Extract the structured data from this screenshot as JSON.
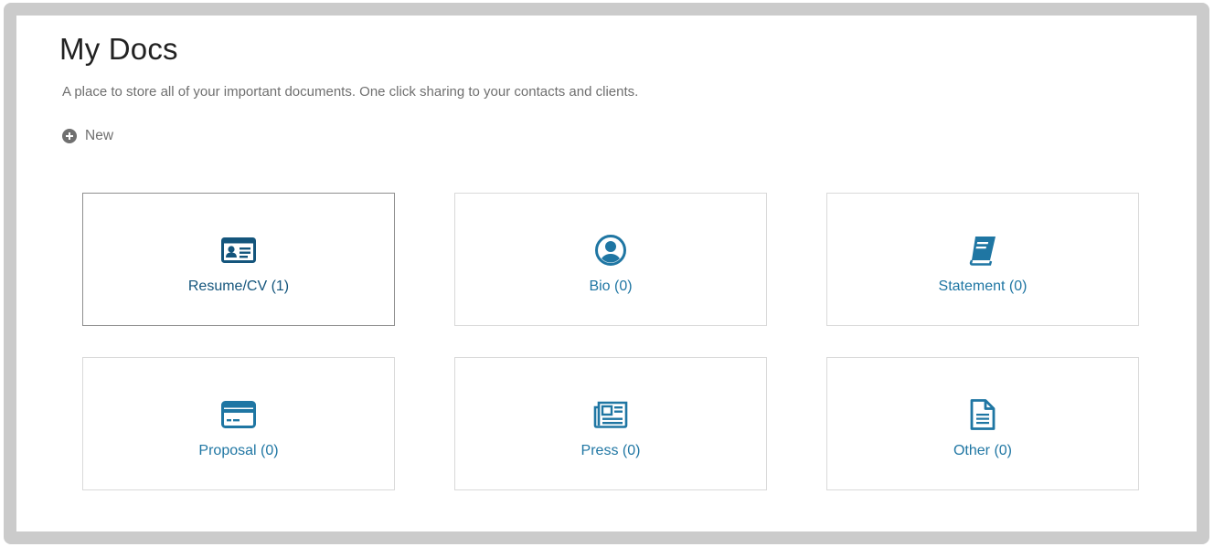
{
  "page": {
    "title": "My Docs",
    "subtitle": "A place to store all of your important documents. One click sharing to your contacts and clients.",
    "new_label": "New"
  },
  "colors": {
    "frame": "#cbcbcb",
    "link": "#1f76a3",
    "link_active": "#14557c",
    "card_border": "#d9d9d9",
    "card_border_active": "#8e8e8e",
    "muted_text": "#6f6f6f"
  },
  "categories": [
    {
      "label": "Resume/CV (1)",
      "icon": "id-card-icon",
      "selected": true
    },
    {
      "label": "Bio (0)",
      "icon": "user-circle-icon",
      "selected": false
    },
    {
      "label": "Statement (0)",
      "icon": "book-icon",
      "selected": false
    },
    {
      "label": "Proposal (0)",
      "icon": "credit-card-icon",
      "selected": false
    },
    {
      "label": "Press (0)",
      "icon": "newspaper-icon",
      "selected": false
    },
    {
      "label": "Other (0)",
      "icon": "file-text-icon",
      "selected": false
    }
  ]
}
